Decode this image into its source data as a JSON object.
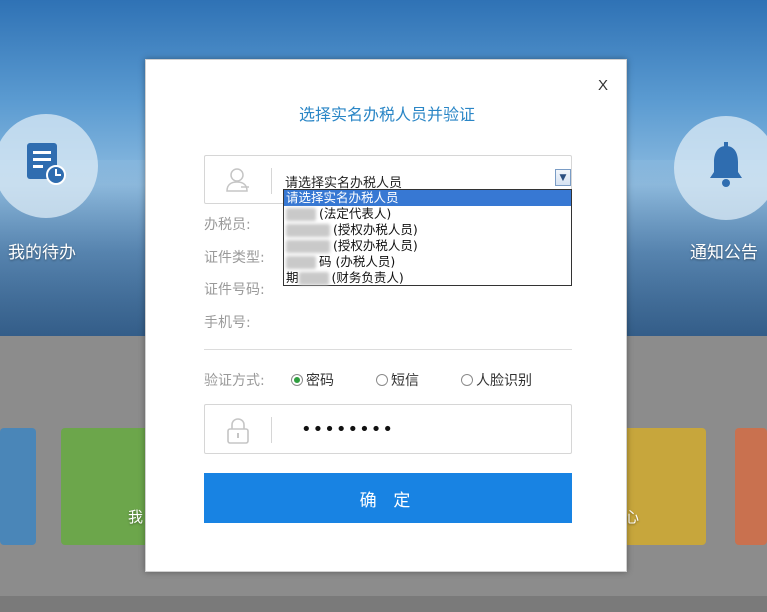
{
  "background": {
    "tiles": [
      {
        "label": "我的待办",
        "icon": "calendar-list-icon"
      },
      {
        "label": "通知公告",
        "icon": "bell-icon"
      }
    ],
    "partial_label_left": "我",
    "partial_label_right": "心"
  },
  "dialog": {
    "close_label": "X",
    "title": "选择实名办税人员并验证",
    "select": {
      "icon": "user-icon",
      "value": "请选择实名办税人员",
      "options": [
        {
          "name": "请选择实名办税人员",
          "role": ""
        },
        {
          "name": "",
          "role": "(法定代表人)"
        },
        {
          "name": "",
          "role": "(授权办税人员)"
        },
        {
          "name": "",
          "role": "(授权办税人员)"
        },
        {
          "name": "",
          "role": "(办税人员)"
        },
        {
          "name": "",
          "role": "(财务负责人)"
        }
      ],
      "option_partial_chars": [
        "",
        "",
        "",
        "",
        "码",
        "期"
      ]
    },
    "fields": {
      "tax_person_label": "办税员:",
      "id_type_label": "证件类型:",
      "id_number_label": "证件号码:",
      "phone_label": "手机号:"
    },
    "verify": {
      "label": "验证方式:",
      "options": [
        {
          "label": "密码",
          "selected": true
        },
        {
          "label": "短信",
          "selected": false
        },
        {
          "label": "人脸识别",
          "selected": false
        }
      ]
    },
    "password": {
      "icon": "lock-icon",
      "value": "••••••••"
    },
    "confirm_label": "确 定"
  },
  "colors": {
    "title": "#2a86c6",
    "button": "#1883e3",
    "radio_selected": "#2f9e3f",
    "dropdown_highlight": "#3778d3"
  }
}
